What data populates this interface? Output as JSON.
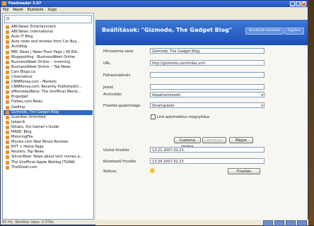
{
  "app": {
    "title": "Feedreader 3.07"
  },
  "menu": [
    "Fájl",
    "Nézet",
    "Eszközök",
    "Súgó"
  ],
  "search": {
    "placeholder": "Q"
  },
  "feeds": [
    "ABCNews: Entertainment",
    "ABCNews: International",
    "Auto IT Blog",
    "Auto news and reviews from Car Buy...",
    "Autoblog",
    "BBC News | News Front Page | UK Edi...",
    "Blogspotting - BusinessWeek Online",
    "BusinessWeek Online -- Investing",
    "BusinessWeek Online -- Top News",
    "Cars Blogs.ca",
    "Cinematical",
    "CNNMoney.com - Markets",
    "CNNMoney.com: Recently Published/U...",
    "eMercedesBenz: The Unofficial Merce...",
    "Engadget",
    "Forbes.com News",
    "Gadling",
    "Gizmodo, The Gadget Blog",
    "Guardian Unlimited",
    "Jalopnik",
    "Kotaku, the Gamer's Guide",
    "MAKE: Blog",
    "MotoringFile",
    "Movies.com New Movie Reviews",
    "NYT > Home Page",
    "Reuters: Top News",
    "SiliconBeat: News about tech money a...",
    "The Unofficial Apple Weblog (TUAW)",
    "TheStreet.com"
  ],
  "selected_feed": "Gizmodo, The Gadget Blog",
  "left_status": "65 Hír, Betöltés ideje: 0.078s",
  "header": {
    "title": "Beállítások: \"Gizmodo, The Gadget Blog\"",
    "btn_back": "Kivetkező elemeket",
    "btn_more": "Egyéb ▾"
  },
  "form": {
    "name_label": "Hírcsatorna neve",
    "name_value": "Gizmodo, The Gadget Blog",
    "url_label": "URL",
    "url_value": "http://gizmodo.com/index.xml",
    "user_label": "Felhasználónév",
    "pass_label": "Jelszó",
    "archive_label": "Archiválás",
    "archive_value": "Alapértelmezett",
    "freq_label": "Frissítés gyakorisága",
    "freq_value": "Smallupdate",
    "auto_open_label": "Link automatikus megnyitása",
    "btn_custom": "Csatorna törlése",
    "btn_move": "Áthelyez",
    "btn_ok": "Mégse",
    "last_update_label": "Utolsó frissítés",
    "last_update_value": "13:21 2007.02.23.",
    "next_update_label": "Következő frissítés",
    "next_update_value": "13:34 2007.02.23.",
    "status_label": "Státusz",
    "btn_refresh": "Frissítés"
  }
}
